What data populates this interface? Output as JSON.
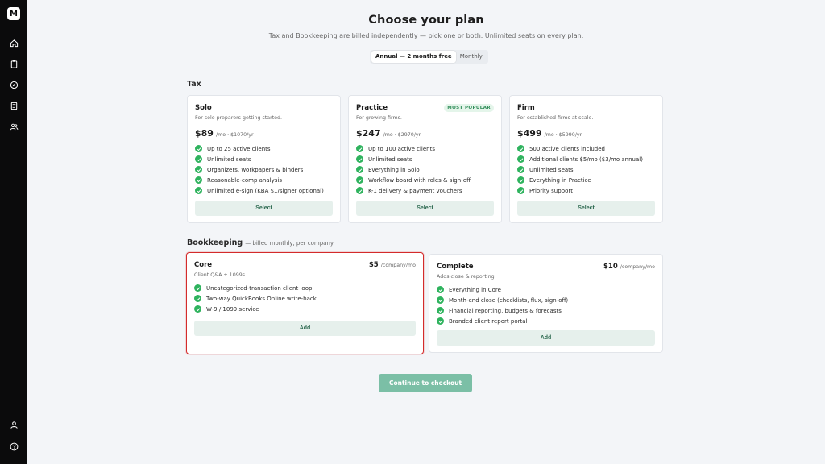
{
  "app": {
    "logo_text": "M"
  },
  "sidebar": {
    "top_icons": [
      "home-icon",
      "clipboard-icon",
      "compass-icon",
      "document-icon",
      "users-icon"
    ],
    "bottom_icons": [
      "user-icon",
      "help-icon"
    ]
  },
  "header": {
    "title": "Choose your plan",
    "subtitle": "Tax and Bookkeeping are billed independently — pick one or both. Unlimited seats on every plan."
  },
  "billing_toggle": {
    "annual": "Annual — 2 months free",
    "monthly": "Monthly",
    "selected": "annual"
  },
  "tax": {
    "heading": "Tax",
    "plans": [
      {
        "name": "Solo",
        "desc": "For solo preparers getting started.",
        "price": "$89",
        "price_note": "/mo · $1070/yr",
        "features": [
          "Up to 25 active clients",
          "Unlimited seats",
          "Organizers, workpapers & binders",
          "Reasonable-comp analysis",
          "Unlimited e-sign (KBA $1/signer optional)"
        ],
        "button": "Select"
      },
      {
        "name": "Practice",
        "badge": "MOST POPULAR",
        "desc": "For growing firms.",
        "price": "$247",
        "price_note": "/mo · $2970/yr",
        "features": [
          "Up to 100 active clients",
          "Unlimited seats",
          "Everything in Solo",
          "Workflow board with roles & sign-off",
          "K-1 delivery & payment vouchers"
        ],
        "button": "Select"
      },
      {
        "name": "Firm",
        "desc": "For established firms at scale.",
        "price": "$499",
        "price_note": "/mo · $5990/yr",
        "features": [
          "500 active clients included",
          "Additional clients $5/mo ($3/mo annual)",
          "Unlimited seats",
          "Everything in Practice",
          "Priority support"
        ],
        "button": "Select"
      }
    ]
  },
  "bookkeeping": {
    "heading": "Bookkeeping",
    "note": "— billed monthly, per company",
    "plans": [
      {
        "name": "Core",
        "desc": "Client Q&A + 1099s.",
        "price": "$5",
        "price_note": "/company/mo",
        "features": [
          "Uncategorized-transaction client loop",
          "Two-way QuickBooks Online write-back",
          "W-9 / 1099 service"
        ],
        "button": "Add",
        "selected": true
      },
      {
        "name": "Complete",
        "desc": "Adds close & reporting.",
        "price": "$10",
        "price_note": "/company/mo",
        "features": [
          "Everything in Core",
          "Month-end close (checklists, flux, sign-off)",
          "Financial reporting, budgets & forecasts",
          "Branded client report portal"
        ],
        "button": "Add"
      }
    ]
  },
  "checkout": {
    "label": "Continue to checkout"
  },
  "colors": {
    "accent_green": "#2fb35e",
    "selected_border": "#d42b2b",
    "checkout_bg": "#7bbfa6",
    "button_bg": "#e6f0ec"
  }
}
